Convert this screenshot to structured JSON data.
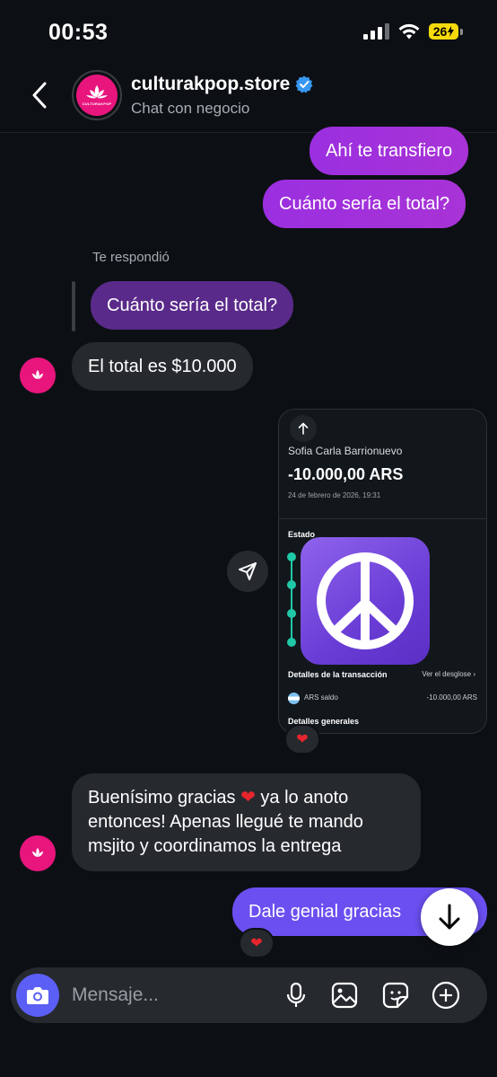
{
  "status_bar": {
    "time": "00:53",
    "battery": "26"
  },
  "header": {
    "name": "culturakpop.store",
    "subtitle": "Chat con negocio",
    "verified": true,
    "logo_text": "CULTURAKPOP"
  },
  "messages": {
    "out1": "Ahí te transfiero",
    "out2": "Cuánto sería el total?",
    "reply_label": "Te respondió",
    "quoted": "Cuánto sería el total?",
    "in1": "El total es $10.000",
    "in2_line1_a": "Buenísimo gracias",
    "in2_line1_b": "ya lo anoto",
    "in2_line2": "entonces! Apenas llegué te mando",
    "in2_line3": "msjito y coordinamos la entrega",
    "out3": "Dale genial gracias"
  },
  "receipt": {
    "name": "Sofia Carla Barrionuevo",
    "amount": "-10.000,00 ARS",
    "date": "24 de febrero de 2026, 19:31",
    "estado": "Estado",
    "details_title": "Detalles de la transacción",
    "details_link": "Ver el desglose",
    "saldo_label": "ARS saldo",
    "saldo_amount": "-10.000,00 ARS",
    "general_title": "Detalles generales"
  },
  "reactions": {
    "receipt": "❤",
    "last_message": "❤",
    "inline_heart": "❤"
  },
  "composer": {
    "placeholder": "Mensaje..."
  },
  "colors": {
    "outgoing": "#a130e0",
    "incoming": "#262a2f",
    "quoted": "#5a2a8a",
    "camera": "#5b5ff5",
    "verified": "#3897f0",
    "teal": "#1fc9a8"
  },
  "icons": [
    "back-chevron-icon",
    "verified-badge-icon",
    "arrow-up-icon",
    "peace-icon",
    "share-icon",
    "arrow-down-icon",
    "camera-icon",
    "microphone-icon",
    "gallery-icon",
    "sticker-icon",
    "plus-icon"
  ]
}
